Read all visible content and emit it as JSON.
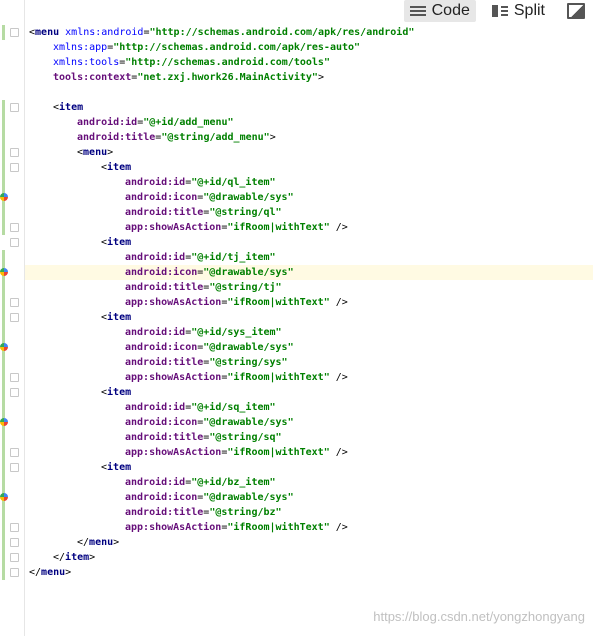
{
  "toolbar": {
    "tabs": [
      {
        "label": "Code",
        "icon": "code-icon",
        "active": true
      },
      {
        "label": "Split",
        "icon": "split-icon",
        "active": false
      },
      {
        "label": "",
        "icon": "design-icon",
        "active": false
      }
    ]
  },
  "code": {
    "lines": [
      {
        "indent": 0,
        "parts": [
          [
            "punct",
            "<"
          ],
          [
            "tag",
            "menu"
          ],
          [
            "punct",
            " "
          ],
          [
            "ns",
            "xmlns:android"
          ],
          [
            "punct",
            "="
          ],
          [
            "val",
            "\"http://schemas.android.com/apk/res/android\""
          ]
        ]
      },
      {
        "indent": 1,
        "parts": [
          [
            "ns",
            "xmlns:app"
          ],
          [
            "punct",
            "="
          ],
          [
            "val",
            "\"http://schemas.android.com/apk/res-auto\""
          ]
        ]
      },
      {
        "indent": 1,
        "parts": [
          [
            "ns",
            "xmlns:tools"
          ],
          [
            "punct",
            "="
          ],
          [
            "val",
            "\"http://schemas.android.com/tools\""
          ]
        ]
      },
      {
        "indent": 1,
        "parts": [
          [
            "attr",
            "tools:context"
          ],
          [
            "punct",
            "="
          ],
          [
            "val",
            "\"net.zxj.hwork26.MainActivity\""
          ],
          [
            "punct",
            ">"
          ]
        ]
      },
      {
        "indent": 0,
        "parts": []
      },
      {
        "indent": 1,
        "parts": [
          [
            "punct",
            "<"
          ],
          [
            "tag",
            "item"
          ]
        ]
      },
      {
        "indent": 2,
        "parts": [
          [
            "attr",
            "android:id"
          ],
          [
            "punct",
            "="
          ],
          [
            "val",
            "\"@+id/add_menu\""
          ]
        ]
      },
      {
        "indent": 2,
        "parts": [
          [
            "attr",
            "android:title"
          ],
          [
            "punct",
            "="
          ],
          [
            "val",
            "\"@string/add_menu\""
          ],
          [
            "punct",
            ">"
          ]
        ]
      },
      {
        "indent": 2,
        "parts": [
          [
            "punct",
            "<"
          ],
          [
            "tag",
            "menu"
          ],
          [
            "punct",
            ">"
          ]
        ]
      },
      {
        "indent": 3,
        "parts": [
          [
            "punct",
            "<"
          ],
          [
            "tag",
            "item"
          ]
        ]
      },
      {
        "indent": 4,
        "parts": [
          [
            "attr",
            "android:id"
          ],
          [
            "punct",
            "="
          ],
          [
            "val",
            "\"@+id/ql_item\""
          ]
        ]
      },
      {
        "indent": 4,
        "parts": [
          [
            "attr",
            "android:icon"
          ],
          [
            "punct",
            "="
          ],
          [
            "val",
            "\"@drawable/sys\""
          ]
        ]
      },
      {
        "indent": 4,
        "parts": [
          [
            "attr",
            "android:title"
          ],
          [
            "punct",
            "="
          ],
          [
            "val",
            "\"@string/ql\""
          ]
        ]
      },
      {
        "indent": 4,
        "parts": [
          [
            "attr",
            "app:showAsAction"
          ],
          [
            "punct",
            "="
          ],
          [
            "val",
            "\"ifRoom|withText\""
          ],
          [
            "punct",
            " />"
          ]
        ]
      },
      {
        "indent": 3,
        "parts": [
          [
            "punct",
            "<"
          ],
          [
            "tag",
            "item"
          ]
        ]
      },
      {
        "indent": 4,
        "parts": [
          [
            "attr",
            "android:id"
          ],
          [
            "punct",
            "="
          ],
          [
            "val",
            "\"@+id/tj_item\""
          ]
        ]
      },
      {
        "indent": 4,
        "parts": [
          [
            "attr",
            "android:icon"
          ],
          [
            "punct",
            "="
          ],
          [
            "val",
            "\"@drawable/sys\""
          ]
        ]
      },
      {
        "indent": 4,
        "parts": [
          [
            "attr",
            "android:title"
          ],
          [
            "punct",
            "="
          ],
          [
            "val",
            "\"@string/tj\""
          ]
        ]
      },
      {
        "indent": 4,
        "parts": [
          [
            "attr",
            "app:showAsAction"
          ],
          [
            "punct",
            "="
          ],
          [
            "val",
            "\"ifRoom|withText\""
          ],
          [
            "punct",
            " />"
          ]
        ]
      },
      {
        "indent": 3,
        "parts": [
          [
            "punct",
            "<"
          ],
          [
            "tag",
            "item"
          ]
        ]
      },
      {
        "indent": 4,
        "parts": [
          [
            "attr",
            "android:id"
          ],
          [
            "punct",
            "="
          ],
          [
            "val",
            "\"@+id/sys_item\""
          ]
        ]
      },
      {
        "indent": 4,
        "parts": [
          [
            "attr",
            "android:icon"
          ],
          [
            "punct",
            "="
          ],
          [
            "val",
            "\"@drawable/sys\""
          ]
        ]
      },
      {
        "indent": 4,
        "parts": [
          [
            "attr",
            "android:title"
          ],
          [
            "punct",
            "="
          ],
          [
            "val",
            "\"@string/sys\""
          ]
        ]
      },
      {
        "indent": 4,
        "parts": [
          [
            "attr",
            "app:showAsAction"
          ],
          [
            "punct",
            "="
          ],
          [
            "val",
            "\"ifRoom|withText\""
          ],
          [
            "punct",
            " />"
          ]
        ]
      },
      {
        "indent": 3,
        "parts": [
          [
            "punct",
            "<"
          ],
          [
            "tag",
            "item"
          ]
        ]
      },
      {
        "indent": 4,
        "parts": [
          [
            "attr",
            "android:id"
          ],
          [
            "punct",
            "="
          ],
          [
            "val",
            "\"@+id/sq_item\""
          ]
        ]
      },
      {
        "indent": 4,
        "parts": [
          [
            "attr",
            "android:icon"
          ],
          [
            "punct",
            "="
          ],
          [
            "val",
            "\"@drawable/sys\""
          ]
        ]
      },
      {
        "indent": 4,
        "parts": [
          [
            "attr",
            "android:title"
          ],
          [
            "punct",
            "="
          ],
          [
            "val",
            "\"@string/sq\""
          ]
        ]
      },
      {
        "indent": 4,
        "parts": [
          [
            "attr",
            "app:showAsAction"
          ],
          [
            "punct",
            "="
          ],
          [
            "val",
            "\"ifRoom|withText\""
          ],
          [
            "punct",
            " />"
          ]
        ]
      },
      {
        "indent": 3,
        "parts": [
          [
            "punct",
            "<"
          ],
          [
            "tag",
            "item"
          ]
        ]
      },
      {
        "indent": 4,
        "parts": [
          [
            "attr",
            "android:id"
          ],
          [
            "punct",
            "="
          ],
          [
            "val",
            "\"@+id/bz_item\""
          ]
        ]
      },
      {
        "indent": 4,
        "parts": [
          [
            "attr",
            "android:icon"
          ],
          [
            "punct",
            "="
          ],
          [
            "val",
            "\"@drawable/sys\""
          ]
        ]
      },
      {
        "indent": 4,
        "parts": [
          [
            "attr",
            "android:title"
          ],
          [
            "punct",
            "="
          ],
          [
            "val",
            "\"@string/bz\""
          ]
        ]
      },
      {
        "indent": 4,
        "parts": [
          [
            "attr",
            "app:showAsAction"
          ],
          [
            "punct",
            "="
          ],
          [
            "val",
            "\"ifRoom|withText\""
          ],
          [
            "punct",
            " />"
          ]
        ]
      },
      {
        "indent": 2,
        "parts": [
          [
            "punct",
            "</"
          ],
          [
            "tag",
            "menu"
          ],
          [
            "punct",
            ">"
          ]
        ]
      },
      {
        "indent": 1,
        "parts": [
          [
            "punct",
            "</"
          ],
          [
            "tag",
            "item"
          ],
          [
            "punct",
            ">"
          ]
        ]
      },
      {
        "indent": 0,
        "parts": [
          [
            "punct",
            "</"
          ],
          [
            "tag",
            "menu"
          ],
          [
            "punct",
            ">"
          ]
        ]
      }
    ]
  },
  "watermark": "https://blog.csdn.net/yongzhongyang"
}
